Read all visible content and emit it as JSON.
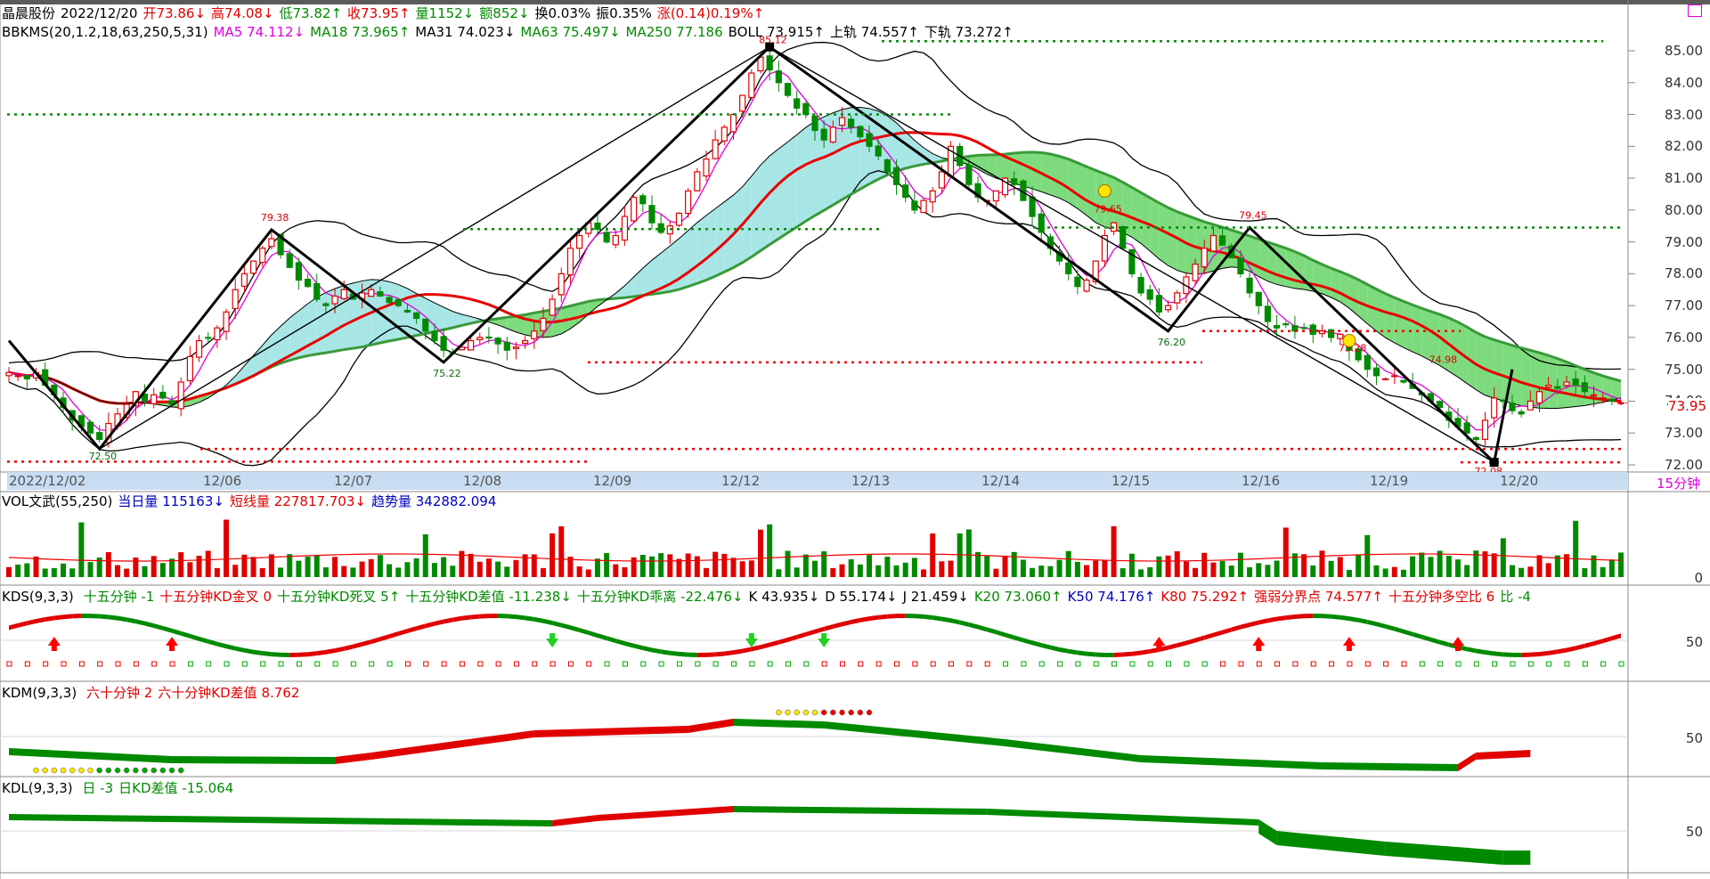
{
  "header": {
    "stock_name": "晶晨股份",
    "date": "2022/12/20",
    "open": "开73.86↓",
    "high": "高74.08↓",
    "low": "低73.82↑",
    "close": "收73.95↑",
    "volume": "量1152↓",
    "amount": "额852↓",
    "turnover": "换0.03%",
    "amplitude": "振0.35%",
    "change": "涨(0.14)0.19%↑"
  },
  "indicator_line": {
    "name": "BBKMS(20,1.2,18,63,250,5,31)",
    "ma5": "MA5 74.112↓",
    "ma18": "MA18 73.965↑",
    "ma31": "MA31 74.023↓",
    "ma63": "MA63 75.497↓",
    "ma250": "MA250 77.186",
    "boll": "BOLL 73.915↑",
    "upper": "上轨 74.557↑",
    "lower": "下轨 73.272↑"
  },
  "price_axis": [
    "85.00",
    "84.00",
    "83.00",
    "82.00",
    "81.00",
    "80.00",
    "79.00",
    "78.00",
    "77.00",
    "76.00",
    "75.00",
    "74.00",
    "73.00",
    "72.00"
  ],
  "current_price": "73.95",
  "period_label": "15分钟",
  "date_axis": [
    "2022/12/02",
    "12/06",
    "12/07",
    "12/08",
    "12/09",
    "12/12",
    "12/13",
    "12/14",
    "12/15",
    "12/16",
    "12/19",
    "12/20"
  ],
  "peak_labels": [
    "79.38",
    "75.22",
    "72.50",
    "85.12",
    "76.20",
    "79.65",
    "79.45",
    "75.28",
    "74.98",
    "72.08"
  ],
  "vol_panel": {
    "name": "VOL文武(55,250)",
    "day_vol": "当日量 115163↓",
    "short_line": "短线量 227817.703↓",
    "trend_vol": "趋势量 342882.094",
    "axis": "0"
  },
  "kds_panel": {
    "name": "KDS(9,3,3)",
    "items": [
      "十五分钟 -1",
      "十五分钟KD金叉 0",
      "十五分钟KD死叉 5↑",
      "十五分钟KD差值 -11.238↓",
      "十五分钟KD乖离 -22.476↓",
      "K 43.935↓",
      "D 55.174↓",
      "J 21.459↓",
      "K20 73.060↑",
      "K50 74.176↑",
      "K80 75.292↑",
      "强弱分界点 74.577↑",
      "十五分钟多空比 6",
      "比 -4"
    ],
    "axis": "50"
  },
  "kdm_panel": {
    "name": "KDM(9,3,3)",
    "items": [
      "六十分钟 2",
      "六十分钟KD差值 8.762"
    ],
    "axis": "50"
  },
  "kdl_panel": {
    "name": "KDL(9,3,3)",
    "items": [
      "日 -3",
      "日KD差值 -15.064"
    ],
    "axis": "50"
  },
  "colors": {
    "up": "#e00000",
    "down": "#008a00",
    "cloud_green": "#7ddb7d",
    "cloud_cyan": "#a8e6e6",
    "ma_red": "#e80000",
    "ma_green": "#3a9a3a",
    "ma5": "#e000e0"
  },
  "chart_data": {
    "type": "candlestick",
    "ylim": [
      71.9,
      85.6
    ],
    "close_series": [
      74.9,
      74.8,
      74.7,
      74.9,
      74.5,
      74.2,
      73.8,
      73.4,
      73.2,
      73.0,
      72.8,
      73.3,
      73.6,
      73.9,
      74.3,
      74.0,
      74.2,
      74.1,
      73.9,
      74.6,
      75.4,
      75.9,
      76.0,
      76.3,
      76.8,
      77.5,
      78.0,
      78.4,
      78.8,
      79.1,
      78.6,
      78.2,
      77.8,
      77.6,
      77.2,
      77.0,
      77.3,
      77.5,
      77.2,
      77.4,
      77.5,
      77.3,
      77.1,
      77.0,
      76.8,
      76.6,
      76.2,
      75.9,
      75.6,
      75.5,
      75.7,
      75.9,
      76.0,
      76.0,
      75.8,
      75.6,
      75.7,
      75.9,
      76.2,
      76.6,
      77.2,
      78.0,
      78.8,
      79.2,
      79.6,
      79.4,
      79.0,
      79.2,
      79.8,
      80.4,
      80.2,
      79.6,
      79.3,
      79.5,
      79.9,
      80.6,
      81.2,
      81.6,
      82.2,
      82.6,
      83.0,
      83.6,
      84.3,
      84.8,
      84.4,
      84.0,
      83.6,
      83.2,
      83.0,
      82.5,
      82.2,
      82.6,
      82.9,
      82.6,
      82.3,
      82.0,
      81.7,
      81.2,
      80.8,
      80.4,
      80.0,
      80.3,
      80.6,
      81.2,
      82.0,
      81.4,
      80.8,
      80.4,
      80.3,
      80.6,
      81.0,
      80.8,
      80.3,
      79.8,
      79.3,
      78.8,
      78.4,
      78.0,
      77.6,
      77.8,
      78.4,
      79.2,
      79.6,
      78.8,
      78.0,
      77.4,
      77.2,
      76.8,
      77.0,
      77.4,
      77.9,
      78.3,
      78.8,
      79.2,
      78.9,
      78.5,
      78.0,
      77.4,
      77.0,
      76.5,
      76.3,
      76.4,
      76.2,
      76.3,
      76.1,
      76.2,
      76.0,
      76.1,
      75.6,
      75.3,
      75.0,
      74.8,
      74.7,
      74.8,
      74.6,
      74.4,
      74.2,
      74.0,
      73.8,
      73.4,
      73.2,
      73.0,
      72.8,
      73.4,
      74.1,
      74.0,
      73.7,
      73.6,
      74.0,
      74.3,
      74.5,
      74.4,
      74.6,
      74.5,
      74.3,
      74.2,
      74.1,
      74.0,
      73.95
    ]
  }
}
